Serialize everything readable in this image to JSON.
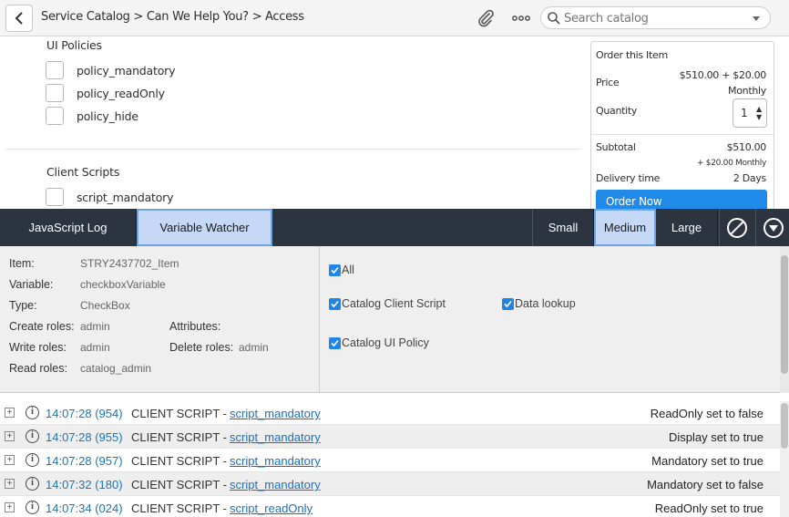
{
  "header": {
    "breadcrumb": "Service Catalog > Can We Help You? > Access",
    "search_placeholder": "Search catalog",
    "more_label": "ooo"
  },
  "form": {
    "ui_policies": {
      "title": "UI Policies",
      "items": [
        "policy_mandatory",
        "policy_readOnly",
        "policy_hide"
      ]
    },
    "client_scripts": {
      "title": "Client Scripts",
      "items": [
        "script_mandatory"
      ]
    }
  },
  "order": {
    "title": "Order this Item",
    "price_label": "Price",
    "price_value": "$510.00 + $20.00",
    "price_period": "Monthly",
    "quantity_label": "Quantity",
    "quantity_value": "1",
    "subtotal_label": "Subtotal",
    "subtotal_value": "$510.00",
    "subtotal_recurring": "+ $20.00 Monthly",
    "delivery_label": "Delivery time",
    "delivery_value": "2 Days",
    "order_button": "Order Now"
  },
  "toolbar": {
    "tabs": [
      "JavaScript Log",
      "Variable Watcher"
    ],
    "active_tab": "Variable Watcher",
    "sizes": [
      "Small",
      "Medium",
      "Large"
    ],
    "active_size": "Medium"
  },
  "watcher": {
    "item_label": "Item:",
    "item_value": "STRY2437702_Item",
    "variable_label": "Variable:",
    "variable_value": "checkboxVariable",
    "type_label": "Type:",
    "type_value": "CheckBox",
    "create_label": "Create roles:",
    "create_value": "admin",
    "attributes_label": "Attributes:",
    "write_label": "Write roles:",
    "write_value": "admin",
    "delete_label": "Delete roles:",
    "delete_value": "admin",
    "read_label": "Read roles:",
    "read_value": "catalog_admin",
    "filters": [
      "All",
      "Catalog Client Script",
      "Data lookup",
      "Catalog UI Policy"
    ]
  },
  "log": [
    {
      "time": "14:07:28 (954)",
      "kind": "CLIENT SCRIPT -",
      "script": "script_mandatory",
      "message": "ReadOnly set to false"
    },
    {
      "time": "14:07:28 (955)",
      "kind": "CLIENT SCRIPT -",
      "script": "script_mandatory",
      "message": "Display set to true"
    },
    {
      "time": "14:07:28 (957)",
      "kind": "CLIENT SCRIPT -",
      "script": "script_mandatory",
      "message": "Mandatory set to true"
    },
    {
      "time": "14:07:32 (180)",
      "kind": "CLIENT SCRIPT -",
      "script": "script_mandatory",
      "message": "Mandatory set to false"
    },
    {
      "time": "14:07:34 (024)",
      "kind": "CLIENT SCRIPT -",
      "script": "script_readOnly",
      "message": "ReadOnly set to true"
    }
  ],
  "colors": {
    "toolbar_bg": "#2c3440",
    "active_tab_bg": "#c5d8f5",
    "accent_blue": "#1f8ae7",
    "log_time": "#1976b4"
  },
  "icons": [
    "back-arrow-icon",
    "paperclip-icon",
    "more-icon",
    "search-icon",
    "dropdown-caret-icon",
    "clear-icon",
    "collapse-icon",
    "expand-icon",
    "info-icon",
    "checkmark-icon"
  ]
}
